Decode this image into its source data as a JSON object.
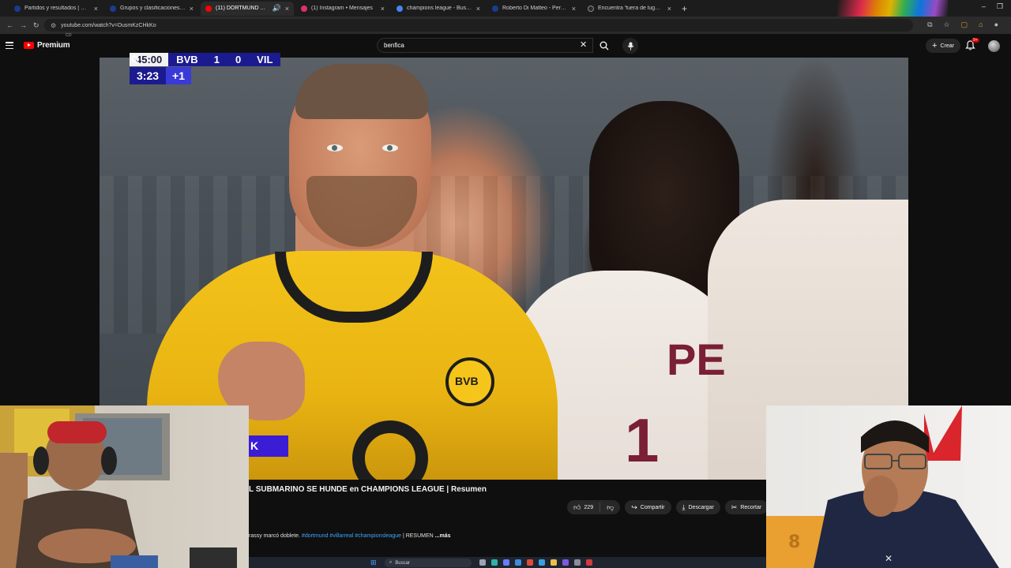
{
  "browser": {
    "tabs": [
      {
        "title": "Partidos y resultados | UEFA Ch",
        "color": "#1a3c8f",
        "active": false,
        "audio": false
      },
      {
        "title": "Grupos y clasificaciones | UEFA",
        "color": "#1a3c8f",
        "active": false,
        "audio": false
      },
      {
        "title": "(11) DORTMUND APLASTO",
        "color": "#ff0000",
        "active": true,
        "audio": true
      },
      {
        "title": "(1) Instagram • Mensajes",
        "color": "#e1306c",
        "active": false,
        "audio": false
      },
      {
        "title": "champions league - Buscar con",
        "color": "#4285f4",
        "active": false,
        "audio": false
      },
      {
        "title": "Roberto Di Matteo - Perfil de",
        "color": "#1a3c8f",
        "active": false,
        "audio": false
      },
      {
        "title": "Encuentra 'fuera de lugar de c",
        "color": "#2a2a2a",
        "active": false,
        "audio": false
      }
    ],
    "url": "youtube.com/watch?v=DusmKzCHkKo"
  },
  "youtube": {
    "logo_text": "Premium",
    "logo_sup": "CO",
    "search_query": "benfica",
    "create_label": "Crear",
    "notification_badge": "9+"
  },
  "video": {
    "scoreboard": {
      "clock": "45:00",
      "home_team": "BVB",
      "home_score": "1",
      "away_score": "0",
      "away_team": "VIL"
    },
    "added_time_clock": "3:23",
    "added_time_plus": "+1",
    "lower_third_text": "K",
    "title": "L SUBMARINO SE HUNDE en CHAMPIONS LEAGUE | Resumen",
    "likes": "229",
    "share_label": "Compartir",
    "download_label": "Descargar",
    "clip_label": "Recortar",
    "description_prefix": "rassy marcó doblete. ",
    "description_tags": "#dortmund #villarreal #championsleague",
    "description_suffix": " | RESUMEN ",
    "description_more": "...más"
  },
  "taskbar": {
    "search_label": "Buscar"
  },
  "colors": {
    "accent_red": "#ff0000",
    "ucl_blue": "#1b1b8f",
    "bvb_yellow": "#f3c31a"
  }
}
